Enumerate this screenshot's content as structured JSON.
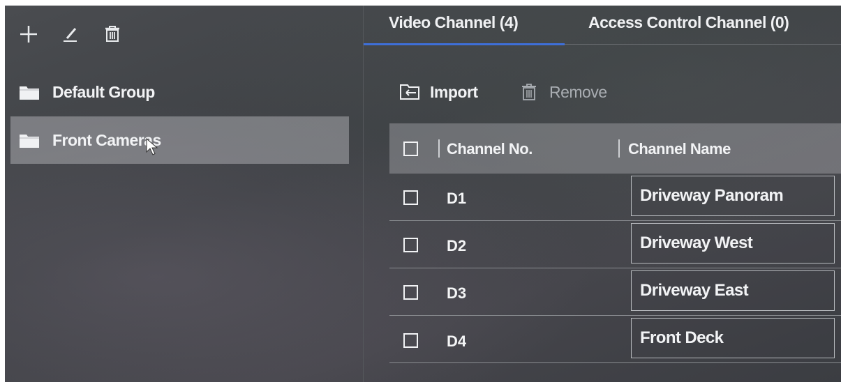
{
  "left_toolbar": {
    "icons": [
      "add-icon",
      "edit-icon",
      "delete-icon"
    ]
  },
  "groups": [
    {
      "label": "Default Group",
      "icon": "folder-icon",
      "selected": false
    },
    {
      "label": "Front Cameras",
      "icon": "folder-icon",
      "selected": true
    }
  ],
  "tabs": [
    {
      "label": "Video Channel (4)",
      "active": true
    },
    {
      "label": "Access Control Channel (0)",
      "active": false
    }
  ],
  "actions": {
    "import_label": "Import",
    "remove_label": "Remove"
  },
  "table": {
    "columns": [
      "Channel No.",
      "Channel Name"
    ],
    "rows": [
      {
        "no": "D1",
        "name": "Driveway Panoram"
      },
      {
        "no": "D2",
        "name": "Driveway West"
      },
      {
        "no": "D3",
        "name": "Driveway East"
      },
      {
        "no": "D4",
        "name": "Front Deck"
      }
    ]
  },
  "colors": {
    "accent": "#3e6fd8",
    "text": "#f2f3f5",
    "disabled_text": "#a9adb2"
  }
}
